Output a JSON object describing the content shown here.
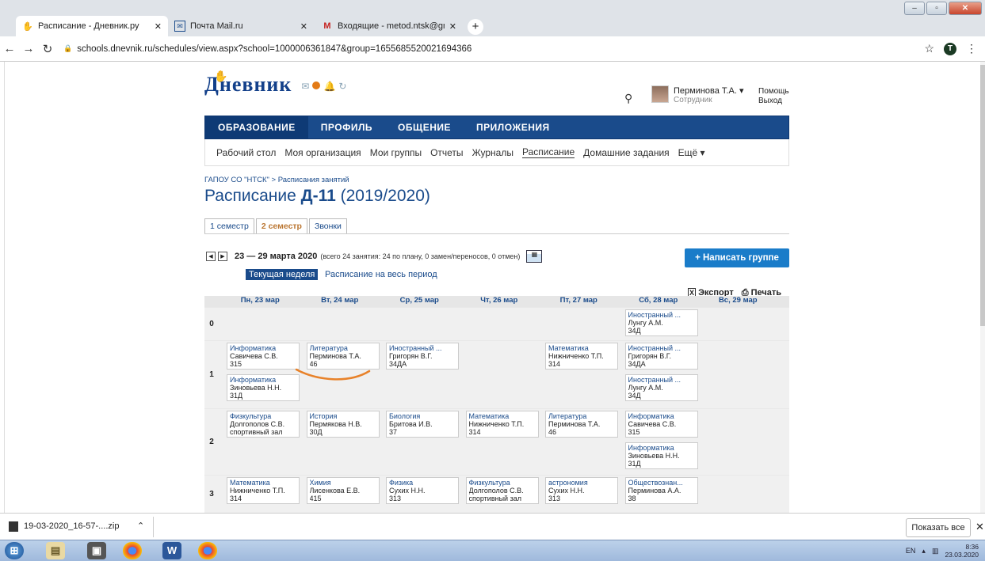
{
  "browser": {
    "tabs": [
      {
        "title": "Расписание - Дневник.ру",
        "favicon": "dnevnik-favicon-icon"
      },
      {
        "title": "Почта Mail.ru",
        "favicon": "mail-favicon-icon"
      },
      {
        "title": "Входящие - metod.ntsk@gmail.c",
        "favicon": "gmail-favicon-icon"
      }
    ],
    "url": "schools.dnevnik.ru/schedules/view.aspx?school=1000006361847&group=1655685520021694366",
    "profile_initial": "T"
  },
  "site": {
    "brand": "Дневник",
    "user_name": "Перминова Т.А. ▾",
    "user_role": "Сотрудник",
    "help": "Помощь",
    "logout": "Выход",
    "main_nav": [
      "ОБРАЗОВАНИЕ",
      "ПРОФИЛЬ",
      "ОБЩЕНИЕ",
      "ПРИЛОЖЕНИЯ"
    ],
    "sub_nav": [
      "Рабочий стол",
      "Моя организация",
      "Мои группы",
      "Отчеты",
      "Журналы",
      "Расписание",
      "Домашние задания",
      "Ещё ▾"
    ],
    "breadcrumb": "ГАПОУ СО \"НТСК\" > Расписания занятий",
    "title_prefix": "Расписание ",
    "title_group": "Д-11",
    "title_year": " (2019/2020)",
    "semester_tabs": [
      "1 семестр",
      "2 семестр",
      "Звонки"
    ],
    "week_range": "23 — 29 марта 2020",
    "week_info": "(всего 24 занятия: 24 по плану, 0 замен/переносов, 0 отмен)",
    "write_group_button": "+ Написать группе",
    "current_week": "Текущая неделя",
    "whole_period": "Расписание на весь период",
    "export": "Экспорт",
    "print": "Печать"
  },
  "schedule": {
    "days": [
      "Пн, 23 мар",
      "Вт, 24 мар",
      "Ср, 25 мар",
      "Чт, 26 мар",
      "Пт, 27 мар",
      "Сб, 28 мар",
      "Вс, 29 мар"
    ],
    "rows": [
      {
        "num": "0",
        "lessons": [
          {
            "day": 5,
            "slot": 0,
            "subject": "Иностранный ...",
            "teacher": "Лунгу А.М.",
            "room": "34Д"
          }
        ]
      },
      {
        "num": "1",
        "lessons": [
          {
            "day": 0,
            "slot": 0,
            "subject": "Информатика",
            "teacher": "Савичева С.В.",
            "room": "315"
          },
          {
            "day": 0,
            "slot": 1,
            "subject": "Информатика",
            "teacher": "Зиновьева Н.Н.",
            "room": "31Д"
          },
          {
            "day": 1,
            "slot": 0,
            "subject": "Литература",
            "teacher": "Перминова Т.А.",
            "room": "46"
          },
          {
            "day": 2,
            "slot": 0,
            "subject": "Иностранный ...",
            "teacher": "Григорян В.Г.",
            "room": "34ДА"
          },
          {
            "day": 4,
            "slot": 0,
            "subject": "Математика",
            "teacher": "Нижниченко Т.П.",
            "room": "314"
          },
          {
            "day": 5,
            "slot": 0,
            "subject": "Иностранный ...",
            "teacher": "Григорян В.Г.",
            "room": "34ДА"
          },
          {
            "day": 5,
            "slot": 1,
            "subject": "Иностранный ...",
            "teacher": "Лунгу А.М.",
            "room": "34Д"
          }
        ]
      },
      {
        "num": "2",
        "lessons": [
          {
            "day": 0,
            "slot": 0,
            "subject": "Физкультура",
            "teacher": "Долгополов С.В.",
            "room": "спортивный зал"
          },
          {
            "day": 1,
            "slot": 0,
            "subject": "История",
            "teacher": "Пермякова Н.В.",
            "room": "30Д"
          },
          {
            "day": 2,
            "slot": 0,
            "subject": "Биология",
            "teacher": "Бритова И.В.",
            "room": "37"
          },
          {
            "day": 3,
            "slot": 0,
            "subject": "Математика",
            "teacher": "Нижниченко Т.П.",
            "room": "314"
          },
          {
            "day": 4,
            "slot": 0,
            "subject": "Литература",
            "teacher": "Перминова Т.А.",
            "room": "46"
          },
          {
            "day": 5,
            "slot": 0,
            "subject": "Информатика",
            "teacher": "Савичева С.В.",
            "room": "315"
          },
          {
            "day": 5,
            "slot": 1,
            "subject": "Информатика",
            "teacher": "Зиновьева Н.Н.",
            "room": "31Д"
          }
        ]
      },
      {
        "num": "3",
        "lessons": [
          {
            "day": 0,
            "slot": 0,
            "subject": "Математика",
            "teacher": "Нижниченко Т.П.",
            "room": "314"
          },
          {
            "day": 1,
            "slot": 0,
            "subject": "Химия",
            "teacher": "Лисенкова Е.В.",
            "room": "415"
          },
          {
            "day": 2,
            "slot": 0,
            "subject": "Физика",
            "teacher": "Сухих Н.Н.",
            "room": "313"
          },
          {
            "day": 3,
            "slot": 0,
            "subject": "Физкультура",
            "teacher": "Долгополов С.В.",
            "room": "спортивный зал"
          },
          {
            "day": 4,
            "slot": 0,
            "subject": "астрономия",
            "teacher": "Сухих Н.Н.",
            "room": "313"
          },
          {
            "day": 5,
            "slot": 0,
            "subject": "Обществознан...",
            "teacher": "Перминова А.А.",
            "room": "38"
          }
        ]
      }
    ]
  },
  "downloads": {
    "file": "19-03-2020_16-57-....zip",
    "show_all": "Показать все"
  },
  "taskbar": {
    "lang": "EN",
    "time": "8:36",
    "date": "23.03.2020"
  },
  "colors": {
    "brand_blue": "#1a4b8b",
    "accent_button": "#1a7cc9",
    "annotation_orange": "#e8822a"
  }
}
